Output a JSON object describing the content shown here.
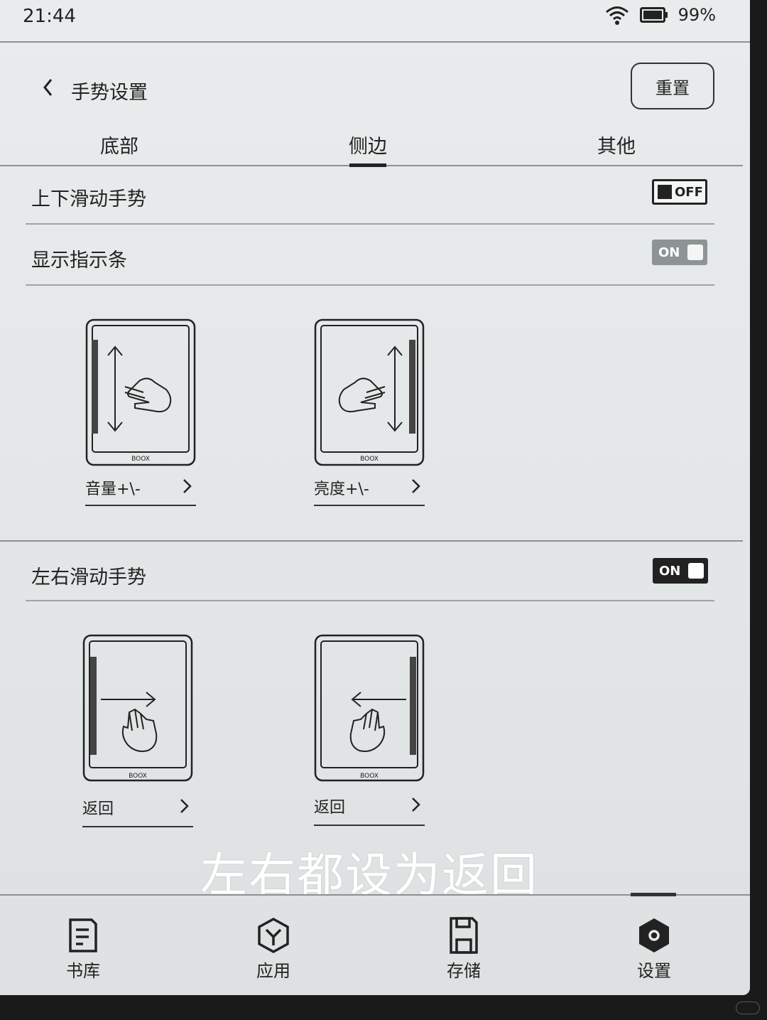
{
  "status_bar": {
    "time": "21:44",
    "battery": "99%"
  },
  "header": {
    "title": "手势设置",
    "reset_label": "重置"
  },
  "tabs": [
    {
      "label": "底部",
      "active": false
    },
    {
      "label": "侧边",
      "active": true
    },
    {
      "label": "其他",
      "active": false
    }
  ],
  "vertical_gesture": {
    "label": "上下滑动手势",
    "toggle": "OFF",
    "indicator_label": "显示指示条",
    "indicator_toggle": "ON",
    "cards": [
      {
        "label": "音量+\\-",
        "brand": "BOOX"
      },
      {
        "label": "亮度+\\-",
        "brand": "BOOX"
      }
    ]
  },
  "horizontal_gesture": {
    "label": "左右滑动手势",
    "toggle": "ON",
    "cards": [
      {
        "label": "返回",
        "brand": "BOOX"
      },
      {
        "label": "返回",
        "brand": "BOOX"
      }
    ]
  },
  "caption": "左右都设为返回",
  "bottom_nav": [
    {
      "label": "书库",
      "icon": "library-icon",
      "active": false
    },
    {
      "label": "应用",
      "icon": "apps-icon",
      "active": false
    },
    {
      "label": "存储",
      "icon": "storage-icon",
      "active": false
    },
    {
      "label": "设置",
      "icon": "settings-icon",
      "active": true
    }
  ],
  "colors": {
    "background": "#e6eaea",
    "ink": "#222222",
    "divider": "#9ea3a3",
    "caption": "#ffffff"
  }
}
